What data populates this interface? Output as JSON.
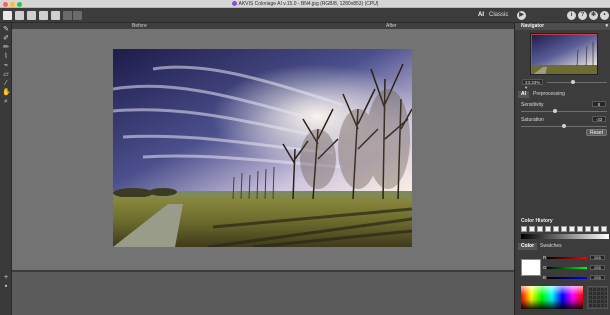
{
  "window": {
    "title": "AKVIS Coloriage AI v.15.0 - BN4.jpg (RGB/8, 1280x853) (CPU)"
  },
  "toolbar": {
    "ai_label": "AI",
    "classic_label": "Classic"
  },
  "views": {
    "before_label": "Before",
    "after_label": "After"
  },
  "navigator": {
    "title": "Navigator",
    "zoom_value": "23.33% ▾"
  },
  "settings": {
    "tabs": [
      "AI",
      "Preprocessing"
    ],
    "sensitivity_label": "Sensitivity",
    "sensitivity_value": "8",
    "saturation_label": "Saturation",
    "saturation_value": "-33",
    "reset_label": "Reset",
    "sensitivity_level": 0.4,
    "saturation_level": 0.5
  },
  "color_history": {
    "title": "Color History"
  },
  "color_panel": {
    "tabs": [
      "Color",
      "Swatches"
    ],
    "r_label": "R",
    "g_label": "G",
    "b_label": "B",
    "r_value": "255",
    "g_value": "255",
    "b_value": "255",
    "current_color": "#ffffff"
  },
  "colors": {
    "toolbar_bg": "#3c3c3c",
    "canvas_bg": "#737373",
    "panel_bg": "#3c3c3c"
  }
}
